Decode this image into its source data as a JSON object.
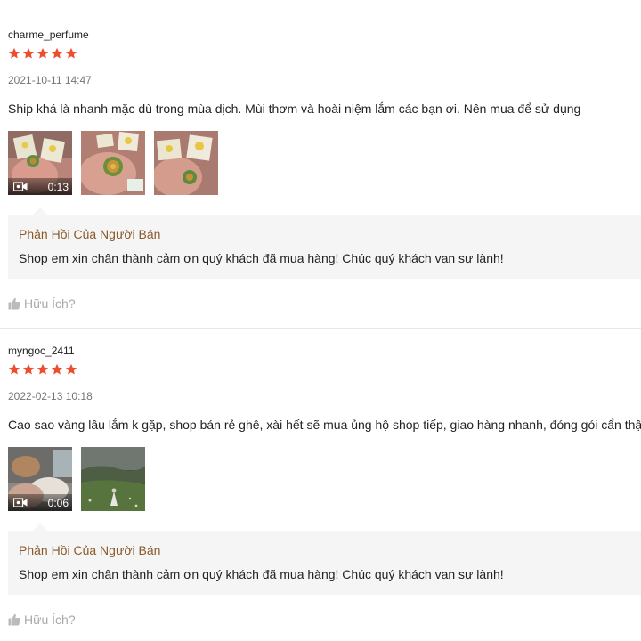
{
  "colors": {
    "star": "#ee4d2d",
    "reply_title": "#8a5a2b",
    "reply_bg": "#f5f5f5",
    "muted": "#757575"
  },
  "reviews": [
    {
      "username": "charme_perfume",
      "rating": 5,
      "date": "2021-10-11 14:47",
      "comment": "Ship khá là nhanh mặc dù trong mùa dịch. Mùi thơm và hoài niệm lắm các bạn ơi. Nên mua để sử dụng",
      "media": [
        {
          "type": "video",
          "duration": "0:13",
          "icon": "video-camera-icon"
        },
        {
          "type": "image"
        },
        {
          "type": "image"
        }
      ],
      "seller_reply": {
        "title": "Phản Hồi Của Người Bán",
        "text": "Shop em xin chân thành cảm ơn quý khách đã mua hàng! Chúc quý khách vạn sự lành!"
      },
      "helpful_label": "Hữu Ích?",
      "helpful_icon": "thumbs-up-icon"
    },
    {
      "username": "myngoc_2411",
      "rating": 5,
      "date": "2022-02-13 10:18",
      "comment": "Cao sao vàng lâu lắm k gặp, shop bán rẻ ghê, xài hết sẽ mua ủng hộ shop tiếp, giao hàng nhanh, đóng gói cẩn thận",
      "media": [
        {
          "type": "video",
          "duration": "0:06",
          "icon": "video-camera-icon"
        },
        {
          "type": "image"
        }
      ],
      "seller_reply": {
        "title": "Phản Hồi Của Người Bán",
        "text": "Shop em xin chân thành cảm ơn quý khách đã mua hàng! Chúc quý khách vạn sự lành!"
      },
      "helpful_label": "Hữu Ích?",
      "helpful_icon": "thumbs-up-icon"
    }
  ]
}
